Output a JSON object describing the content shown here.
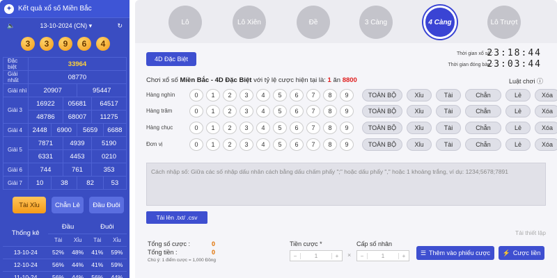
{
  "sidebar": {
    "title": "Kết quả xổ số Miền Bắc",
    "date": "13-10-2024 (CN)",
    "balls": [
      "3",
      "3",
      "9",
      "6",
      "4"
    ],
    "results": [
      {
        "label": "Đặc biệt",
        "values": [
          "33964"
        ]
      },
      {
        "label": "Giải nhất",
        "values": [
          "08770"
        ]
      },
      {
        "label": "Giải nhì",
        "values": [
          "20907",
          "95447"
        ]
      },
      {
        "label": "Giải 3",
        "values": [
          "16922",
          "05681",
          "64517",
          "48786",
          "68007",
          "11275"
        ]
      },
      {
        "label": "Giải 4",
        "values": [
          "2448",
          "6900",
          "5659",
          "6688"
        ]
      },
      {
        "label": "Giải 5",
        "values": [
          "7871",
          "4939",
          "5190",
          "6331",
          "4453",
          "0210"
        ]
      },
      {
        "label": "Giải 6",
        "values": [
          "744",
          "761",
          "353"
        ]
      },
      {
        "label": "Giải 7",
        "values": [
          "10",
          "38",
          "82",
          "53"
        ]
      }
    ],
    "tabs": [
      "Tài Xỉu",
      "Chẵn Lẻ",
      "Đầu Đuôi"
    ],
    "stats": {
      "title": "Thống kê",
      "group1": "Đầu",
      "group2": "Đuôi",
      "cols": [
        "Tài",
        "Xỉu",
        "Tài",
        "Xỉu"
      ],
      "rows": [
        [
          "13-10-24",
          "52%",
          "48%",
          "41%",
          "59%"
        ],
        [
          "12-10-24",
          "56%",
          "44%",
          "41%",
          "59%"
        ],
        [
          "11-10-24",
          "56%",
          "44%",
          "56%",
          "44%"
        ]
      ]
    }
  },
  "main": {
    "tabs": [
      "Lô",
      "Lô Xiên",
      "Đề",
      "3 Càng",
      "4 Càng",
      "Lô Trượt"
    ],
    "active_tab": "4 Càng",
    "subtype": "4D Đặc Biệt",
    "time_label_1": "Thời gian xổ số :",
    "time_1": "23:18:44",
    "time_label_2": "Thời gian đóng bàn :",
    "time_2": "23:03:44",
    "play_prefix": "Chơi xổ số ",
    "play_region": "Miền Bắc - 4D Đặc Biệt",
    "play_mid": " với tỷ lệ cược hiện tại là: ",
    "rate_a": "1",
    "rate_mid": " ăn ",
    "rate_b": "8800",
    "rules": "Luật chơi",
    "rows": [
      "Hàng nghìn",
      "Hàng trăm",
      "Hàng chục",
      "Đơn vị"
    ],
    "digits": [
      "0",
      "1",
      "2",
      "3",
      "4",
      "5",
      "6",
      "7",
      "8",
      "9"
    ],
    "quick": [
      "TOÀN BỘ",
      "Xỉu",
      "Tài",
      "Chẵn",
      "Lẻ",
      "Xóa"
    ],
    "input_hint": "Cách nhập số: Giữa các số nhập dấu nhân cách bằng dấu chấm phẩy \";\" hoặc dấu phẩy \",\" hoặc 1 khoảng trắng, ví dụ: 1234;5678;7891",
    "upload": "Tải lên .txt/ .csv",
    "download": "Tải thiết lập",
    "total_bet_label": "Tổng số cược :",
    "total_bet": "0",
    "total_money_label": "Tổng tiền :",
    "total_money": "0",
    "note": "Chú ý: 1 điểm cược = 1,000 Đồng",
    "bet_label": "Tiền cược *",
    "bet_value": "1",
    "mult_label": "Cấp số nhân",
    "mult_value": "1",
    "add_btn": "Thêm vào phiếu cược",
    "quick_btn": "Cược liền"
  }
}
